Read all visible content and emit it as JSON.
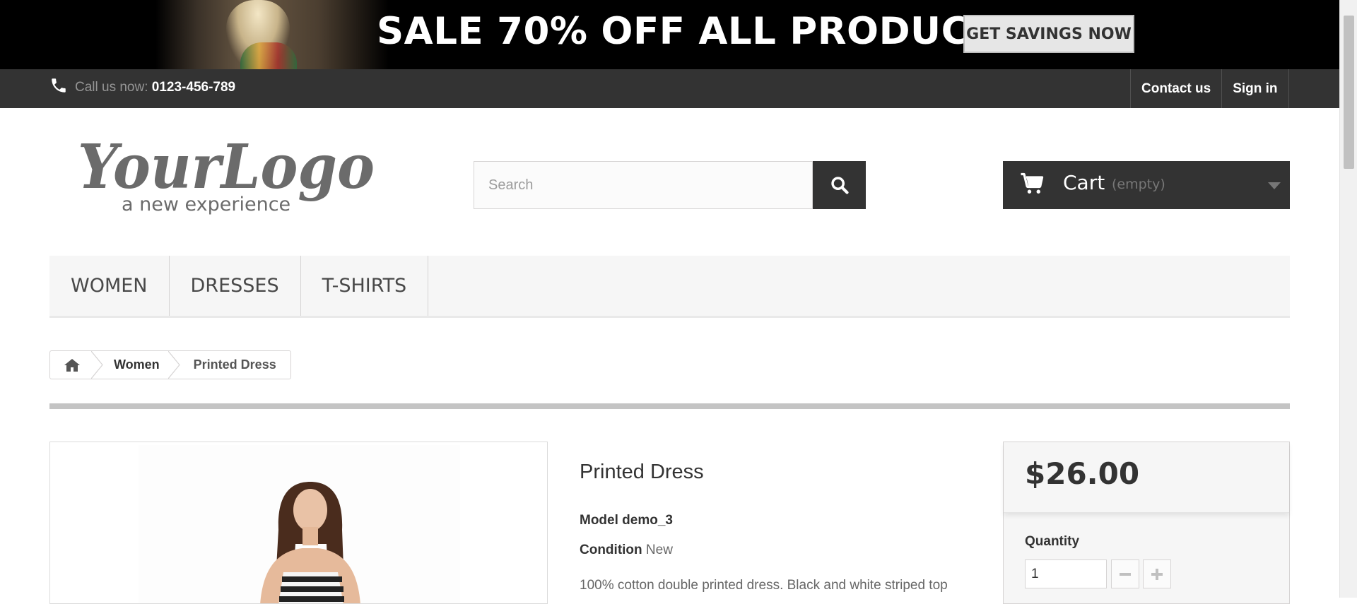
{
  "banner": {
    "headline": "SALE 70% OFF ALL PRODUCTS",
    "cta_label": "GET SAVINGS NOW"
  },
  "topbar": {
    "call_prefix": "Call us now:",
    "phone": "0123-456-789",
    "links": [
      "Contact us",
      "Sign in"
    ]
  },
  "header": {
    "logo_text": "YourLogo",
    "logo_tagline": "a new experience",
    "search_placeholder": "Search",
    "cart_label": "Cart",
    "cart_status": "(empty)"
  },
  "menu": {
    "items": [
      "WOMEN",
      "DRESSES",
      "T-SHIRTS"
    ]
  },
  "breadcrumb": {
    "items": [
      "Women",
      "Printed Dress"
    ]
  },
  "product": {
    "title": "Printed Dress",
    "model_label": "Model",
    "model_value": "demo_3",
    "condition_label": "Condition",
    "condition_value": "New",
    "description": "100% cotton double printed dress. Black and white striped top",
    "price": "$26.00",
    "quantity_label": "Quantity",
    "quantity_value": "1"
  },
  "icons": [
    "phone-icon",
    "search-icon",
    "cart-icon",
    "chevron-down-icon",
    "home-icon",
    "minus-icon",
    "plus-icon"
  ],
  "colors": {
    "dark": "#333333",
    "banner_bg": "#000000",
    "menu_bg": "#f6f6f6",
    "muted": "#777777"
  }
}
